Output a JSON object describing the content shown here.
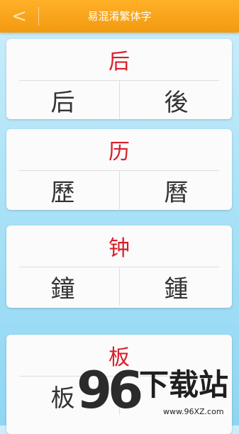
{
  "header": {
    "back_glyph": "<",
    "title": "易混淆繁体字"
  },
  "cards": [
    {
      "main": "后",
      "variants": [
        "后",
        "後"
      ]
    },
    {
      "main": "历",
      "variants": [
        "歷",
        "曆"
      ]
    },
    {
      "main": "钟",
      "variants": [
        "鐘",
        "鍾"
      ]
    },
    {
      "main": "板",
      "variants": [
        "板",
        ""
      ]
    }
  ],
  "watermark": {
    "logo": "96",
    "text": "下载站",
    "url": "www.96XZ.com"
  },
  "colors": {
    "header": "#f5a318",
    "main_char": "#d8202a",
    "variant_char": "#333333"
  }
}
